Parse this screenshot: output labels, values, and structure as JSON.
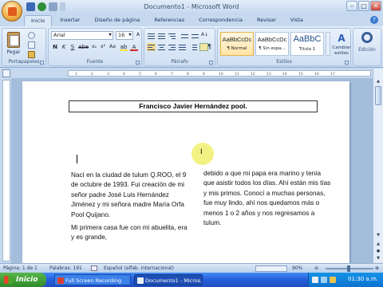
{
  "window": {
    "title": "Documento1 - Microsoft Word",
    "controls": [
      "–",
      "□",
      "✕"
    ]
  },
  "ribbon": {
    "tabs": [
      "Inicio",
      "Insertar",
      "Diseño de página",
      "Referencias",
      "Correspondencia",
      "Revisar",
      "Vista"
    ],
    "active_tab": "Inicio",
    "clipboard": {
      "label": "Portapapeles",
      "paste": "Pegar"
    },
    "font": {
      "label": "Fuente",
      "font_name": "Arial",
      "font_size": "16"
    },
    "paragraph": {
      "label": "Párrafo"
    },
    "styles": {
      "label": "Estilos",
      "items": [
        {
          "sample": "AaBbCcDc",
          "name": "¶ Normal"
        },
        {
          "sample": "AaBbCcDc",
          "name": "¶ Sin espa..."
        },
        {
          "sample": "AaBbC",
          "name": "Título 1"
        }
      ],
      "change_label": "Cambiar estilos"
    },
    "editing": {
      "label": "Edición"
    }
  },
  "ruler": {
    "ticks": [
      "1",
      "2",
      "3",
      "4",
      "5",
      "6",
      "7",
      "8",
      "9",
      "10",
      "11",
      "12",
      "13",
      "14",
      "15",
      "16",
      "17"
    ]
  },
  "document": {
    "title": "Francisco Javier Hernández pool.",
    "left_column": [
      "Nací en la ciudad de tulum Q.ROO, el 9 de octubre de 1993. Fui creación de mi señor padre José Luis Hernández Jiménez y mi señora madre María Orfa Pool Quijano.",
      "Mi primera casa fue con mi abuelita, era y es grande,"
    ],
    "right_column": [
      "debido a que mi papa era marino y tenía que asistir todos los días. Ahí están mis tías y mis primos. Conocí a muchas personas, fue muy lindo, ahí nos quedamos más o menos 1 o 2 años y nos regresamos a tulum."
    ]
  },
  "status_bar": {
    "page": "Página: 1 de 1",
    "words": "Palabras: 191",
    "language": "Español (alfab. internacional)",
    "zoom": "90%"
  },
  "taskbar": {
    "start": "Inicio",
    "tasks": [
      "Full Screen Recording",
      "Documento1 - Micros..."
    ],
    "time": "01:30 a.m."
  }
}
